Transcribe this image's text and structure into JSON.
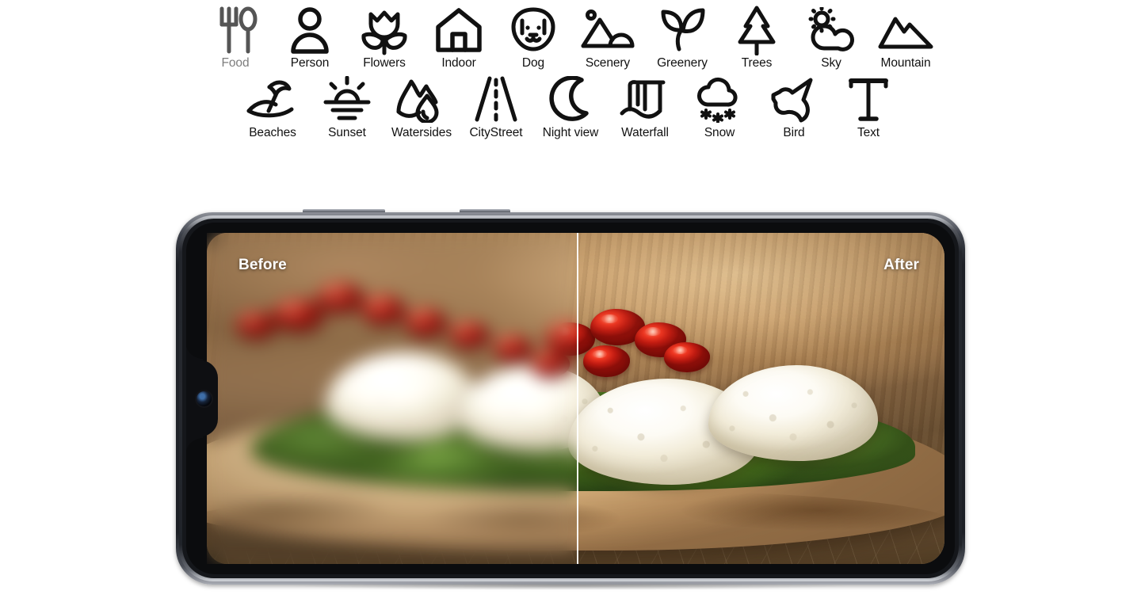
{
  "scene_categories": {
    "row1": [
      {
        "label": "Food",
        "icon": "fork-spoon-icon",
        "muted": true
      },
      {
        "label": "Person",
        "icon": "person-icon",
        "muted": false
      },
      {
        "label": "Flowers",
        "icon": "tulip-icon",
        "muted": false
      },
      {
        "label": "Indoor",
        "icon": "house-icon",
        "muted": false
      },
      {
        "label": "Dog",
        "icon": "dog-face-icon",
        "muted": false
      },
      {
        "label": "Scenery",
        "icon": "landscape-icon",
        "muted": false
      },
      {
        "label": "Greenery",
        "icon": "leaves-icon",
        "muted": false
      },
      {
        "label": "Trees",
        "icon": "pine-tree-icon",
        "muted": false
      },
      {
        "label": "Sky",
        "icon": "sun-cloud-icon",
        "muted": false
      },
      {
        "label": "Mountain",
        "icon": "mountain-icon",
        "muted": false
      }
    ],
    "row2": [
      {
        "label": "Beaches",
        "icon": "beach-umbrella-icon",
        "muted": false
      },
      {
        "label": "Sunset",
        "icon": "sunset-icon",
        "muted": false
      },
      {
        "label": "Watersides",
        "icon": "waterside-icon",
        "muted": false
      },
      {
        "label": "CityStreet",
        "icon": "road-icon",
        "muted": false
      },
      {
        "label": "Night view",
        "icon": "crescent-moon-icon",
        "muted": false
      },
      {
        "label": "Waterfall",
        "icon": "waterfall-icon",
        "muted": false
      },
      {
        "label": "Snow",
        "icon": "cloud-snow-icon",
        "muted": false
      },
      {
        "label": "Bird",
        "icon": "bird-icon",
        "muted": false
      },
      {
        "label": "Text",
        "icon": "text-t-icon",
        "muted": false
      }
    ]
  },
  "device": {
    "orientation": "landscape",
    "frame_color": "#20232a",
    "notch": "waterdrop-notch",
    "front_camera": "front-camera-lens",
    "buttons": [
      "volume-rocker",
      "power-button"
    ]
  },
  "comparison": {
    "before_label": "Before",
    "after_label": "After",
    "divider_position_percent": 50,
    "divider_color": "#ffffff",
    "label_color": "#ffffff",
    "subject": "flatbread with ricotta, spinach and roasted tomatoes"
  },
  "palette": {
    "label_active": "#111111",
    "label_muted": "#7d7d7d",
    "background": "#ffffff"
  }
}
